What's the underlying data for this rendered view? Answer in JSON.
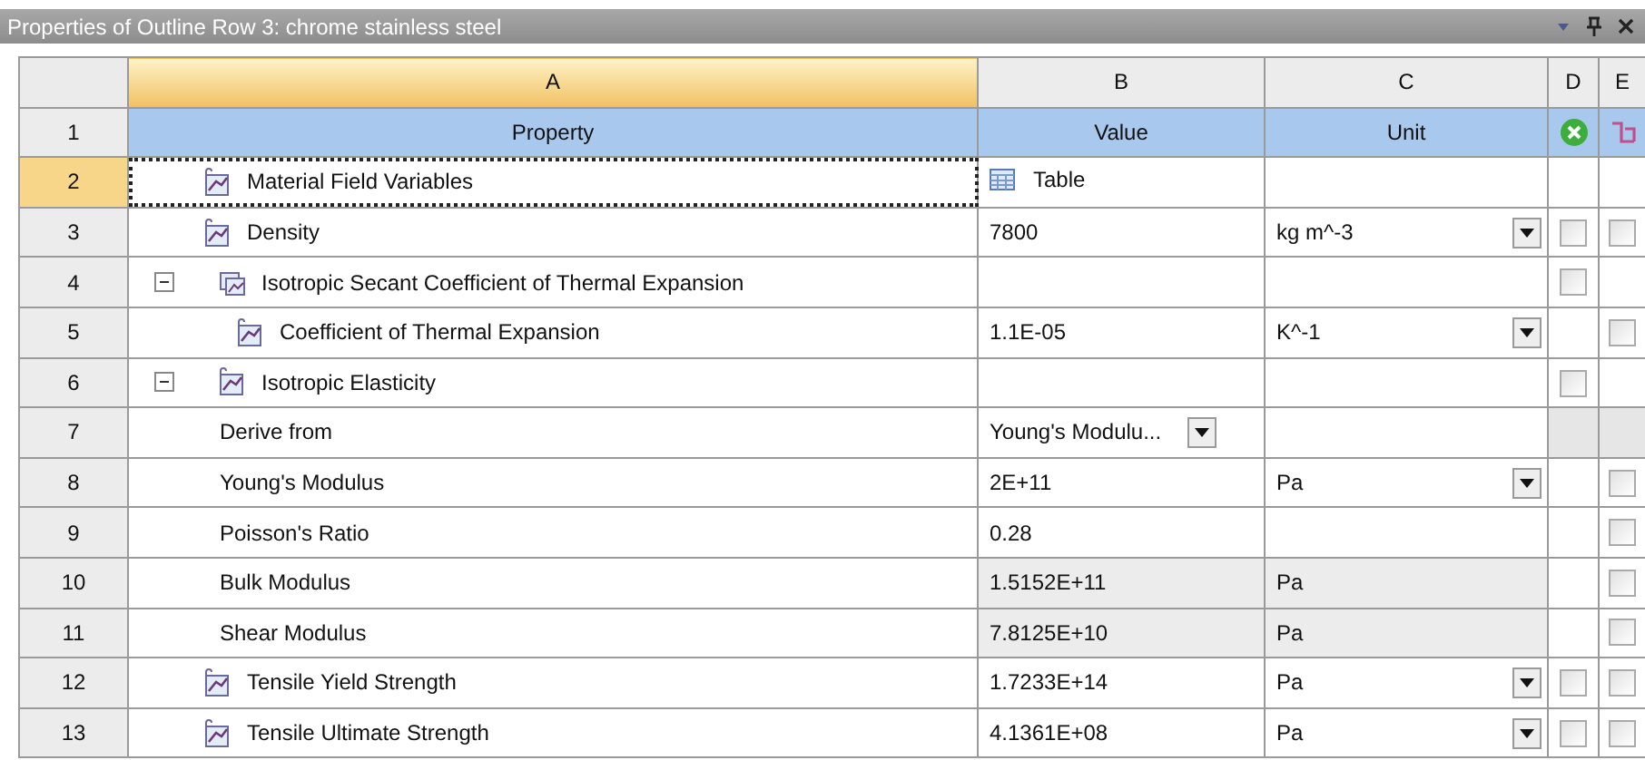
{
  "panel": {
    "title": "Properties of Outline Row 3: chrome stainless steel"
  },
  "columns": [
    {
      "letter": "A",
      "selected": true
    },
    {
      "letter": "B",
      "selected": false
    },
    {
      "letter": "C",
      "selected": false
    },
    {
      "letter": "D",
      "selected": false
    },
    {
      "letter": "E",
      "selected": false
    }
  ],
  "header_row": {
    "number": "1",
    "property": "Property",
    "value": "Value",
    "unit": "Unit"
  },
  "rows": [
    {
      "number": "2",
      "kind": "property",
      "property": "Material Field Variables",
      "value": {
        "kind": "table",
        "text": "Table"
      },
      "unit_dropdown": false,
      "readonly": false,
      "locked": false,
      "selected": true
    },
    {
      "number": "3",
      "kind": "property",
      "property": "Density",
      "value": {
        "kind": "text",
        "text": "7800"
      },
      "unit": "kg m^-3",
      "unit_dropdown": true,
      "readonly": false,
      "locked": false,
      "selected": false,
      "d": {
        "checked": false
      },
      "e": {
        "checked": false
      }
    },
    {
      "number": "4",
      "kind": "group",
      "expanded": true,
      "property": "Isotropic Secant Coefficient of Thermal Expansion",
      "unit_dropdown": false,
      "readonly": false,
      "locked": false,
      "selected": false,
      "d": {
        "checked": false
      },
      "children": [
        {
          "number": "5",
          "kind": "property",
          "property": "Coefficient of Thermal Expansion",
          "value": {
            "kind": "text",
            "text": "1.1E-05"
          },
          "unit": "K^-1",
          "unit_dropdown": true,
          "readonly": false,
          "locked": false,
          "selected": false,
          "e": {
            "checked": false
          }
        }
      ]
    },
    {
      "number": "6",
      "kind": "property",
      "expanded": true,
      "property": "Isotropic Elasticity",
      "unit_dropdown": false,
      "readonly": false,
      "locked": false,
      "selected": false,
      "d": {
        "checked": false
      },
      "children": [
        {
          "number": "7",
          "kind": "plain",
          "property": "Derive from",
          "value": {
            "kind": "dropdown",
            "text": "Young's Modulu..."
          },
          "unit_dropdown": false,
          "readonly": false,
          "locked": true,
          "selected": false
        },
        {
          "number": "8",
          "kind": "plain",
          "property": "Young's Modulus",
          "value": {
            "kind": "text",
            "text": "2E+11"
          },
          "unit": "Pa",
          "unit_dropdown": true,
          "readonly": false,
          "locked": false,
          "selected": false,
          "e": {
            "checked": false
          }
        },
        {
          "number": "9",
          "kind": "plain",
          "property": "Poisson's Ratio",
          "value": {
            "kind": "text",
            "text": "0.28"
          },
          "unit_dropdown": false,
          "readonly": false,
          "locked": false,
          "selected": false,
          "e": {
            "checked": false
          }
        },
        {
          "number": "10",
          "kind": "plain",
          "property": "Bulk Modulus",
          "value": {
            "kind": "text",
            "text": "1.5152E+11"
          },
          "unit": "Pa",
          "unit_dropdown": false,
          "readonly": true,
          "locked": false,
          "selected": false,
          "e": {
            "checked": false
          }
        },
        {
          "number": "11",
          "kind": "plain",
          "property": "Shear Modulus",
          "value": {
            "kind": "text",
            "text": "7.8125E+10"
          },
          "unit": "Pa",
          "unit_dropdown": false,
          "readonly": true,
          "locked": false,
          "selected": false,
          "e": {
            "checked": false
          }
        }
      ]
    },
    {
      "number": "12",
      "kind": "property",
      "property": "Tensile Yield Strength",
      "value": {
        "kind": "text",
        "text": "1.7233E+14"
      },
      "unit": "Pa",
      "unit_dropdown": true,
      "readonly": false,
      "locked": false,
      "selected": false,
      "d": {
        "checked": false
      },
      "e": {
        "checked": false
      }
    },
    {
      "number": "13",
      "kind": "property",
      "property": "Tensile Ultimate Strength",
      "value": {
        "kind": "text",
        "text": "4.1361E+08"
      },
      "unit": "Pa",
      "unit_dropdown": true,
      "readonly": false,
      "locked": false,
      "selected": false,
      "d": {
        "checked": false
      },
      "e": {
        "checked": false
      }
    }
  ]
}
